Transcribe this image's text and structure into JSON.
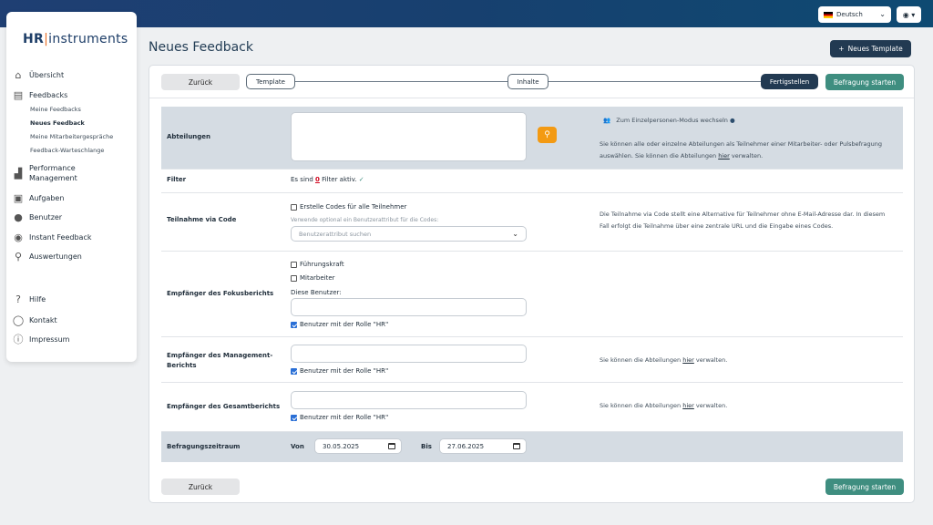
{
  "topbar": {
    "language": "Deutsch",
    "user_icon": "user-circle-icon"
  },
  "brand": {
    "hr": "HR",
    "rest": "instruments"
  },
  "sidebar": {
    "items": [
      {
        "label": "Übersicht",
        "icon": "home-icon"
      },
      {
        "label": "Feedbacks",
        "icon": "clipboard-icon"
      },
      {
        "label": "Performance Management",
        "icon": "chart-icon"
      },
      {
        "label": "Aufgaben",
        "icon": "tasks-icon"
      },
      {
        "label": "Benutzer",
        "icon": "user-icon"
      },
      {
        "label": "Instant Feedback",
        "icon": "chat-icon"
      },
      {
        "label": "Auswertungen",
        "icon": "analytics-icon"
      },
      {
        "label": "Hilfe",
        "icon": "help-icon"
      },
      {
        "label": "Kontakt",
        "icon": "speech-bubble-icon"
      },
      {
        "label": "Impressum",
        "icon": "info-icon"
      }
    ],
    "perf_line1": "Performance",
    "perf_line2": "Management",
    "sub": [
      "Meine Feedbacks",
      "Neues Feedback",
      "Meine Mitarbeitergespräche",
      "Feedback-Warteschlange"
    ]
  },
  "page": {
    "title": "Neues Feedback",
    "new_template": "Neues Template"
  },
  "wizard": {
    "back": "Zurück",
    "start": "Befragung starten",
    "steps": [
      "Template",
      "Inhalte",
      "Fertigstellen"
    ]
  },
  "form": {
    "departments": {
      "label": "Abteilungen",
      "switch_mode": "Zum Einzelpersonen-Modus wechseln",
      "hint_pre": "Sie können alle oder einzelne Abteilungen als Teilnehmer einer Mitarbeiter- oder Pulsbefragung auswählen. Sie können die Abteilungen",
      "hint_link": "hier",
      "hint_post": "verwalten."
    },
    "filter": {
      "label": "Filter",
      "pre": "Es sind",
      "count": "0",
      "post": "Filter aktiv.",
      "check": "✓"
    },
    "code": {
      "label": "Teilnahme via Code",
      "checkbox": "Erstelle Codes für alle Teilnehmer",
      "optional": "Verwende optional ein Benutzerattribut für die Codes:",
      "select_placeholder": "Benutzerattribut suchen",
      "hint": "Die Teilnahme via Code stellt eine Alternative für Teilnehmer ohne E-Mail-Adresse dar. In diesem Fall erfolgt die Teilnahme über eine zentrale URL und die Eingabe eines Codes."
    },
    "focus": {
      "label": "Empfänger des Fokusberichts",
      "opt1": "Führungskraft",
      "opt2": "Mitarbeiter",
      "these_users": "Diese Benutzer:",
      "hr": "Benutzer mit der Rolle \"HR\""
    },
    "management": {
      "label1": "Empfänger des Management-",
      "label2": "Berichts",
      "hr": "Benutzer mit der Rolle \"HR\"",
      "hint_pre": "Sie können die Abteilungen",
      "hint_link": "hier",
      "hint_post": "verwalten."
    },
    "overall": {
      "label": "Empfänger des Gesamtberichts",
      "hr": "Benutzer mit der Rolle \"HR\"",
      "hint_pre": "Sie können die Abteilungen",
      "hint_link": "hier",
      "hint_post": "verwalten."
    },
    "period": {
      "label": "Befragungszeitraum",
      "from_label": "Von",
      "from": "30.05.2025",
      "to_label": "Bis",
      "to": "27.06.2025"
    }
  }
}
